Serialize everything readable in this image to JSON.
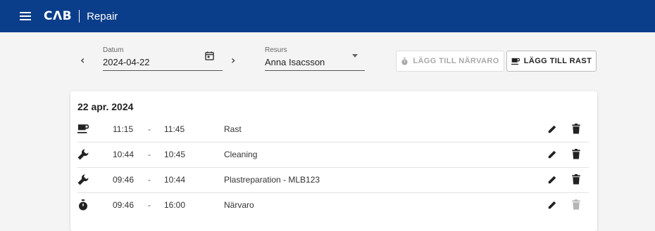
{
  "header": {
    "logo": "CΛB",
    "title": "Repair"
  },
  "filters": {
    "datum_label": "Datum",
    "datum_value": "2024-04-22",
    "resurs_label": "Resurs",
    "resurs_value": "Anna Isacsson"
  },
  "actions": {
    "add_presence_label": "LÄGG TILL NÄRVARO",
    "add_break_label": "LÄGG TILL RAST"
  },
  "card": {
    "title": "22 apr. 2024",
    "rows": [
      {
        "icon": "coffee-icon",
        "start": "11:15",
        "dash": "-",
        "end": "11:45",
        "desc": "Rast",
        "delete_enabled": true
      },
      {
        "icon": "wrench-icon",
        "start": "10:44",
        "dash": "-",
        "end": "10:45",
        "desc": "Cleaning",
        "delete_enabled": true
      },
      {
        "icon": "wrench-icon",
        "start": "09:46",
        "dash": "-",
        "end": "10:44",
        "desc": "Plastreparation - MLB123",
        "delete_enabled": true
      },
      {
        "icon": "stopwatch-icon",
        "start": "09:46",
        "dash": "-",
        "end": "16:00",
        "desc": "Närvaro",
        "delete_enabled": false
      }
    ]
  },
  "colors": {
    "topbar": "#0a3d8a",
    "disabled": "#a9a9a9"
  }
}
